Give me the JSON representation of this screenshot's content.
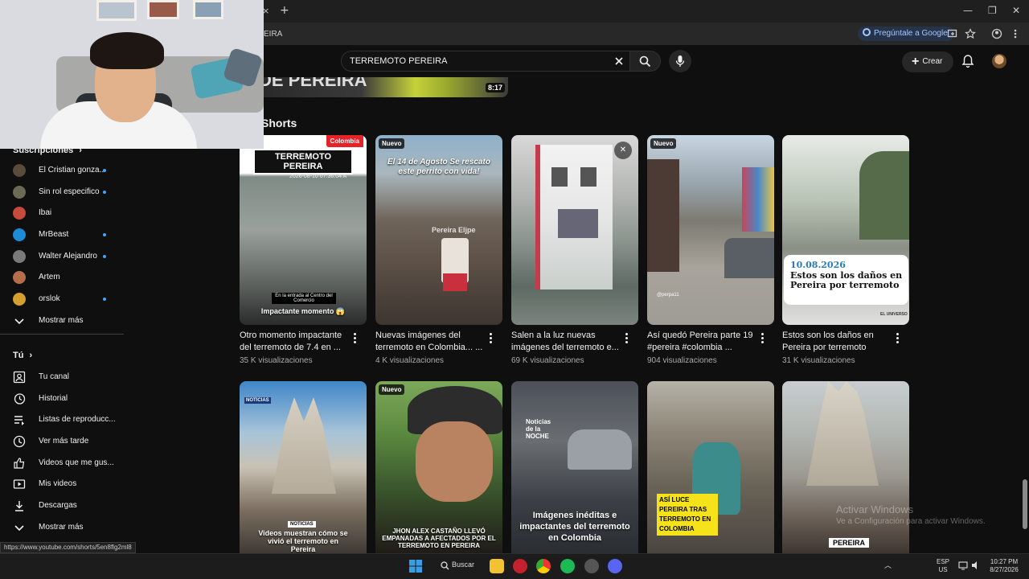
{
  "browser": {
    "url_fragment": "EIRA",
    "ask_google_label": "Pregúntale a Google",
    "new_tab": "+",
    "close_tab": "×",
    "minimize": "—",
    "restore": "❐",
    "close_window": "✕"
  },
  "header": {
    "search": {
      "value": "TERREMOTO PEREIRA",
      "placeholder": "Buscar"
    },
    "create_label": "Crear"
  },
  "top_video": {
    "title_fragment": "DE PEREIRA",
    "duration": "8:17"
  },
  "section_title": "Shorts",
  "sidebar": {
    "subscriptions_heading": "Suscripciones",
    "subscriptions": [
      {
        "label": "El Cristian gonza...",
        "color": "#5a4a3a",
        "dot": true
      },
      {
        "label": "Sin rol especifico",
        "color": "#6b6b55",
        "dot": true
      },
      {
        "label": "Ibai",
        "color": "#c64b3a",
        "dot": false
      },
      {
        "label": "MrBeast",
        "color": "#1d8bd6",
        "dot": true
      },
      {
        "label": "Walter Alejandro",
        "color": "#7a7a7a",
        "dot": true
      },
      {
        "label": "Artem",
        "color": "#b46f4a",
        "dot": false
      },
      {
        "label": "orslok",
        "color": "#d4a032",
        "dot": true
      }
    ],
    "show_more_1": "Mostrar más",
    "you_heading": "Tú",
    "you_items": [
      {
        "label": "Tu canal",
        "icon": "channel-icon"
      },
      {
        "label": "Historial",
        "icon": "history-icon"
      },
      {
        "label": "Listas de reproducc...",
        "icon": "playlists-icon"
      },
      {
        "label": "Ver más tarde",
        "icon": "watch-later-icon"
      },
      {
        "label": "Videos que me gus...",
        "icon": "like-icon"
      },
      {
        "label": "Mis videos",
        "icon": "my-videos-icon"
      },
      {
        "label": "Descargas",
        "icon": "download-icon"
      }
    ],
    "show_more_2": "Mostrar más"
  },
  "shorts_row1": [
    {
      "title": "Otro momento impactante del terremoto de 7.4  en ...",
      "views": "35 K visualizaciones",
      "badge": "Colombia",
      "overlay_top": "TERREMOTO PEREIRA",
      "stamp": "2026-08-10 07:36:04 A",
      "overlay_bottom_small": "En la entrada al Centro del Comercio",
      "overlay_bottom": "Impactante momento 😱"
    },
    {
      "title": "Nuevas imágenes del terremoto en Colombia... ...",
      "views": "4 K visualizaciones",
      "badge": "Nuevo",
      "overlay_top": "El 14 de Agosto Se rescato este perrito con vida!",
      "watermark": "Pereira Eljpe"
    },
    {
      "title": "Salen a la luz nuevas imágenes del terremoto e...",
      "views": "69 K visualizaciones"
    },
    {
      "title": "Así quedó Pereira parte 19 #pereira #colombia ...",
      "views": "904 visualizaciones",
      "badge": "Nuevo",
      "handle": "@perpa11"
    },
    {
      "title": "Estos son los daños en Pereira por terremoto",
      "views": "31 K visualizaciones",
      "card_date": "10.08.2026",
      "card_text": "Estos son los daños en Pereira por terremoto",
      "source": "EL UNIVERSO"
    }
  ],
  "shorts_row2": [
    {
      "badge_small": "NOTICIAS",
      "tag": "NOTICIAS",
      "overlay_bottom": "Videos muestran cómo se vivió el terremoto en Pereira"
    },
    {
      "badge": "Nuevo",
      "overlay_bottom": "JHON ALEX CASTAÑO LLEVÓ EMPANADAS A AFECTADOS POR EL TERREMOTO EN PEREIRA"
    },
    {
      "logo": "Noticias de la NOCHE",
      "overlay_bottom": "Imágenes inéditas e impactantes del terremoto en Colombia"
    },
    {
      "overlay_bottom": "ASÍ LUCE PEREIRA TRAS TERREMOTO EN COLOMBIA"
    },
    {
      "overlay_bottom": "PEREIRA"
    }
  ],
  "status_url": "https://www.youtube.com/shorts/5en8flg2ml8",
  "watermark": {
    "line1": "Activar Windows",
    "line2": "Ve a Configuración para activar Windows."
  },
  "taskbar": {
    "search_label": "Buscar",
    "lang_1": "ESP",
    "lang_2": "US",
    "time": "10:27 PM",
    "date": "8/27/2026"
  }
}
